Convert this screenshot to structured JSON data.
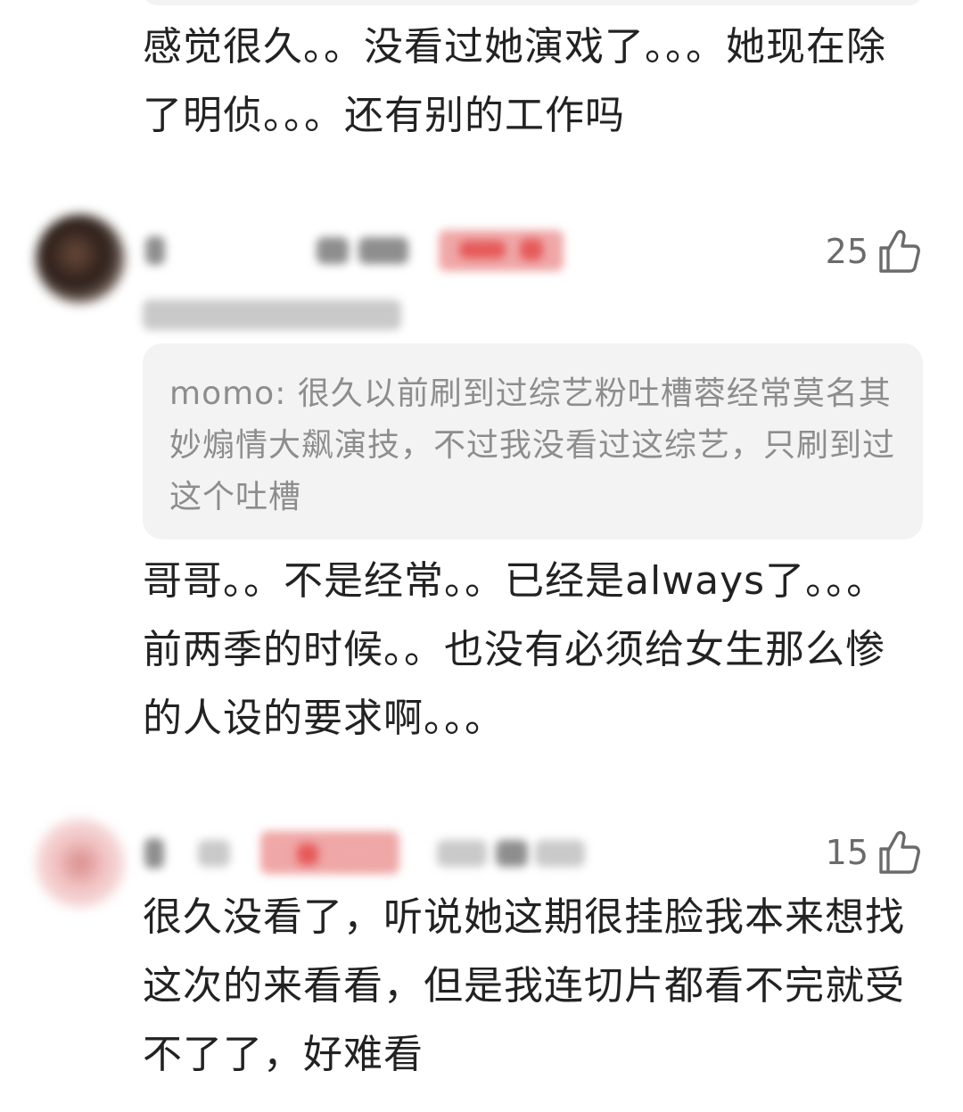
{
  "comment_top": {
    "text": "感觉很久。。没看过她演戏了。。。她现在除了明侦。。。还有别的工作吗"
  },
  "comment_1": {
    "likes": "25",
    "quote": {
      "author": "momo",
      "separator": ": ",
      "text": "很久以前刷到过综艺粉吐槽蓉经常莫名其妙煽情大飙演技，不过我没看过这综艺，只刷到过这个吐槽"
    },
    "text": "哥哥。。不是经常。。已经是always了。。。前两季的时候。。也没有必须给女生那么惨的人设的要求啊。。。"
  },
  "comment_2": {
    "likes": "15",
    "text": "很久没看了，听说她这期很挂脸我本来想找这次的来看看，但是我连切片都看不完就受不了了，好难看"
  },
  "icons": {
    "like": "thumbs-up-icon"
  },
  "colors": {
    "text": "#222222",
    "muted": "#8d8d8d",
    "card": "#f3f3f3",
    "like": "#6b6b6b"
  }
}
